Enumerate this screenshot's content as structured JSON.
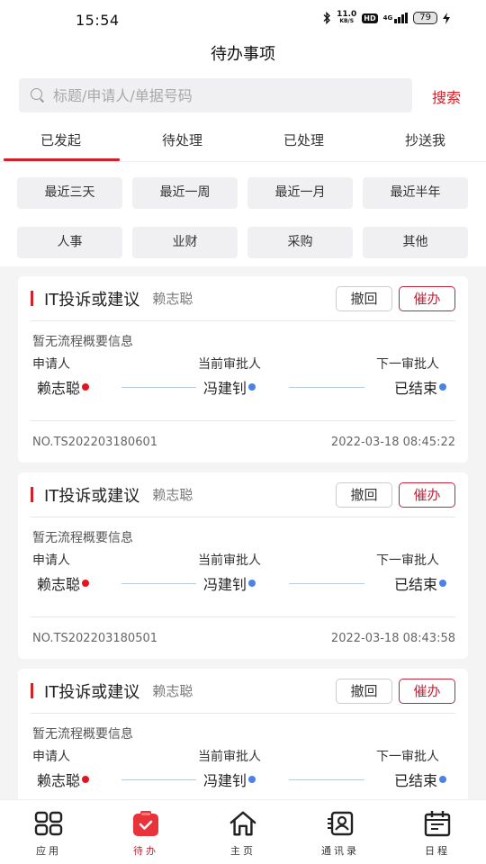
{
  "status_bar": {
    "time": "15:54",
    "net_speed_value": "11.0",
    "net_speed_unit": "KB/S",
    "hd": "HD",
    "network": "4G",
    "battery": "79"
  },
  "header": {
    "title": "待办事项"
  },
  "search": {
    "placeholder": "标题/申请人/单据号码",
    "value": "",
    "button_label": "搜索"
  },
  "tabs": [
    {
      "label": "已发起",
      "active": true
    },
    {
      "label": "待处理",
      "active": false
    },
    {
      "label": "已处理",
      "active": false
    },
    {
      "label": "抄送我",
      "active": false
    }
  ],
  "filters": {
    "time": [
      "最近三天",
      "最近一周",
      "最近一月",
      "最近半年"
    ],
    "category": [
      "人事",
      "业财",
      "采购",
      "其他"
    ]
  },
  "cards": [
    {
      "title": "IT投诉或建议",
      "author": "赖志聪",
      "recall_label": "撤回",
      "urge_label": "催办",
      "summary": "暂无流程概要信息",
      "applicant_label": "申请人",
      "current_label": "当前审批人",
      "next_label": "下一审批人",
      "applicant": "赖志聪",
      "current": "冯建钊",
      "next": "已结束",
      "number": "NO.TS202203180601",
      "datetime": "2022-03-18 08:45:22"
    },
    {
      "title": "IT投诉或建议",
      "author": "赖志聪",
      "recall_label": "撤回",
      "urge_label": "催办",
      "summary": "暂无流程概要信息",
      "applicant_label": "申请人",
      "current_label": "当前审批人",
      "next_label": "下一审批人",
      "applicant": "赖志聪",
      "current": "冯建钊",
      "next": "已结束",
      "number": "NO.TS202203180501",
      "datetime": "2022-03-18 08:43:58"
    },
    {
      "title": "IT投诉或建议",
      "author": "赖志聪",
      "recall_label": "撤回",
      "urge_label": "催办",
      "summary": "暂无流程概要信息",
      "applicant_label": "申请人",
      "current_label": "当前审批人",
      "next_label": "下一审批人",
      "applicant": "赖志聪",
      "current": "冯建钊",
      "next": "已结束",
      "number": "",
      "datetime": ""
    }
  ],
  "bottom_nav": [
    {
      "label": "应用",
      "icon": "grid-icon",
      "active": false
    },
    {
      "label": "待办",
      "icon": "todo-clipboard-icon",
      "active": true
    },
    {
      "label": "主页",
      "icon": "home-icon",
      "active": false
    },
    {
      "label": "通讯录",
      "icon": "contacts-icon",
      "active": false
    },
    {
      "label": "日程",
      "icon": "calendar-icon",
      "active": false
    }
  ],
  "colors": {
    "accent": "#d0202a",
    "urge": "#c0263a",
    "applicant_dot": "#e3151f",
    "approver_dot": "#4c82e8",
    "background": "#f4f4f5"
  }
}
